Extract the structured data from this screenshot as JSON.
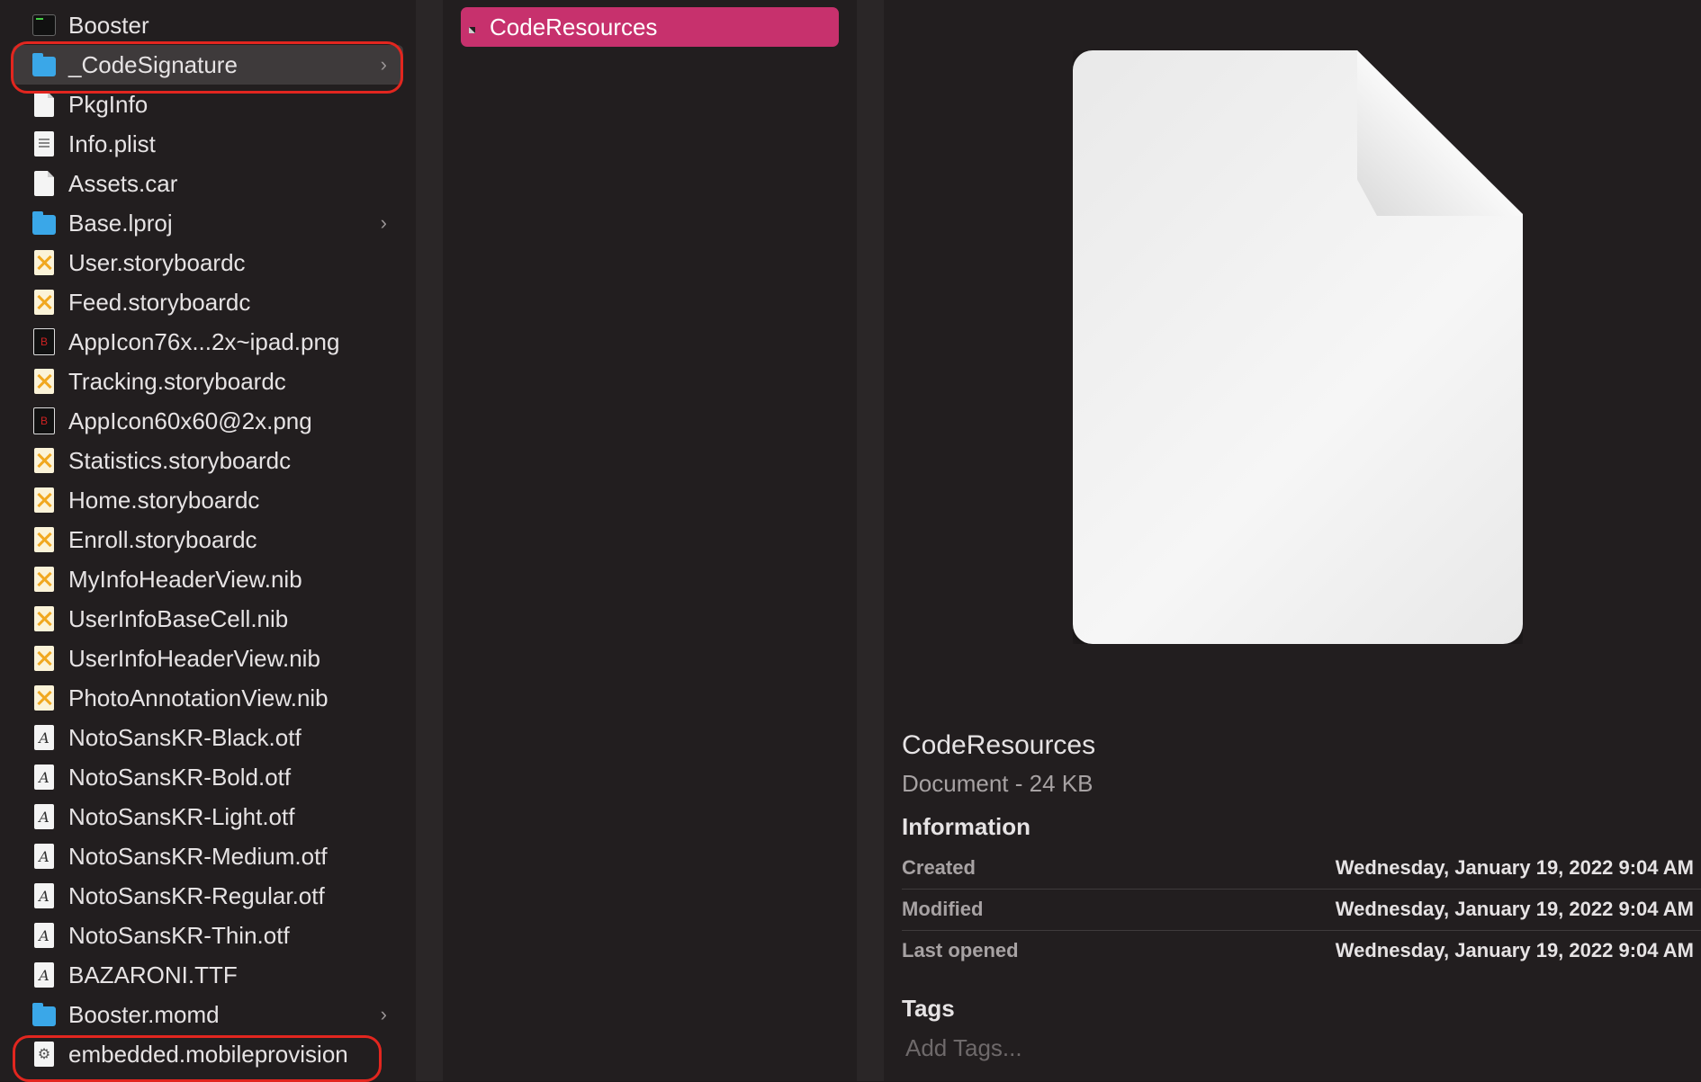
{
  "column1": {
    "items": [
      {
        "label": "Booster",
        "icon": "terminal-icon"
      },
      {
        "label": "_CodeSignature",
        "icon": "folder-icon",
        "chevron": "›"
      },
      {
        "label": "PkgInfo",
        "icon": "document-icon"
      },
      {
        "label": "Info.plist",
        "icon": "plist-icon"
      },
      {
        "label": "Assets.car",
        "icon": "document-icon"
      },
      {
        "label": "Base.lproj",
        "icon": "folder-icon",
        "chevron": "›"
      },
      {
        "label": "User.storyboardc",
        "icon": "storyboard-icon"
      },
      {
        "label": "Feed.storyboardc",
        "icon": "storyboard-icon"
      },
      {
        "label": "AppIcon76x...2x~ipad.png",
        "icon": "png-icon"
      },
      {
        "label": "Tracking.storyboardc",
        "icon": "storyboard-icon"
      },
      {
        "label": "AppIcon60x60@2x.png",
        "icon": "png-icon"
      },
      {
        "label": "Statistics.storyboardc",
        "icon": "storyboard-icon"
      },
      {
        "label": "Home.storyboardc",
        "icon": "storyboard-icon"
      },
      {
        "label": "Enroll.storyboardc",
        "icon": "storyboard-icon"
      },
      {
        "label": "MyInfoHeaderView.nib",
        "icon": "storyboard-icon"
      },
      {
        "label": "UserInfoBaseCell.nib",
        "icon": "storyboard-icon"
      },
      {
        "label": "UserInfoHeaderView.nib",
        "icon": "storyboard-icon"
      },
      {
        "label": "PhotoAnnotationView.nib",
        "icon": "storyboard-icon"
      },
      {
        "label": "NotoSansKR-Black.otf",
        "icon": "font-icon"
      },
      {
        "label": "NotoSansKR-Bold.otf",
        "icon": "font-icon"
      },
      {
        "label": "NotoSansKR-Light.otf",
        "icon": "font-icon"
      },
      {
        "label": "NotoSansKR-Medium.otf",
        "icon": "font-icon"
      },
      {
        "label": "NotoSansKR-Regular.otf",
        "icon": "font-icon"
      },
      {
        "label": "NotoSansKR-Thin.otf",
        "icon": "font-icon"
      },
      {
        "label": "BAZARONI.TTF",
        "icon": "font-icon"
      },
      {
        "label": "Booster.momd",
        "icon": "folder-icon",
        "chevron": "›"
      },
      {
        "label": "embedded.mobileprovision",
        "icon": "provision-icon"
      }
    ]
  },
  "column2": {
    "selected_file": "CodeResources"
  },
  "preview": {
    "file_name": "CodeResources",
    "subtitle": "Document - 24 KB",
    "information_header": "Information",
    "info": [
      {
        "key": "Created",
        "value": "Wednesday, January 19, 2022 9:04 AM"
      },
      {
        "key": "Modified",
        "value": "Wednesday, January 19, 2022 9:04 AM"
      },
      {
        "key": "Last opened",
        "value": "Wednesday, January 19, 2022 9:04 AM"
      }
    ],
    "tags_header": "Tags",
    "tags_placeholder": "Add Tags..."
  },
  "colors": {
    "selection": "#c7316d",
    "annotation_ring": "#e2261f",
    "folder": "#3aa7e8"
  }
}
